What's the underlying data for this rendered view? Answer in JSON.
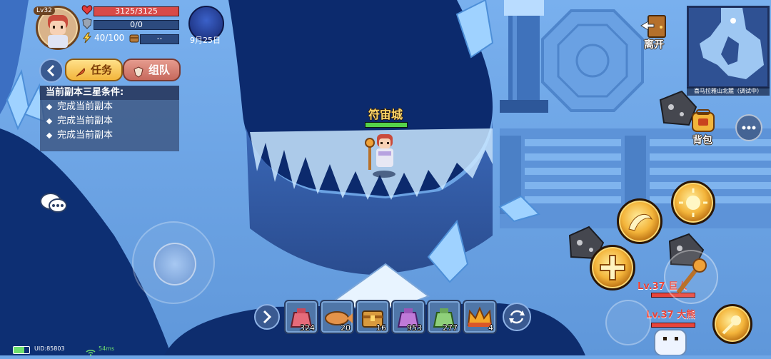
{
  "player": {
    "level": "Lv32",
    "hp": "3125/3125",
    "shield": "0/0",
    "energy": "40/100",
    "item_value": "--",
    "date": "9月25日"
  },
  "panel": {
    "tabs": [
      {
        "label": "任务"
      },
      {
        "label": "组队"
      }
    ],
    "title": "当前副本三星条件:",
    "conditions": [
      "完成当前副本",
      "完成当前副本",
      "完成当前副本"
    ]
  },
  "hud": {
    "leave_label": "离开",
    "bag_label": "背包",
    "minimap_caption": "喜马拉雅山北麓（调试中）",
    "hero_name": "符宙城",
    "enemies": [
      {
        "label": "Lv.37 巨人"
      },
      {
        "label": "Lv.37 大熊"
      }
    ]
  },
  "hotbar": {
    "items": [
      {
        "icon": "red-pouch-icon",
        "count": "324"
      },
      {
        "icon": "roast-fish-icon",
        "count": "20"
      },
      {
        "icon": "treasure-chest-icon",
        "count": "16"
      },
      {
        "icon": "purple-pouch-icon",
        "count": "953"
      },
      {
        "icon": "green-pouch-icon",
        "count": "277"
      },
      {
        "icon": "fire-crown-icon",
        "count": "4"
      }
    ]
  },
  "status": {
    "uid": "UID:85803",
    "ping": "54ms"
  }
}
